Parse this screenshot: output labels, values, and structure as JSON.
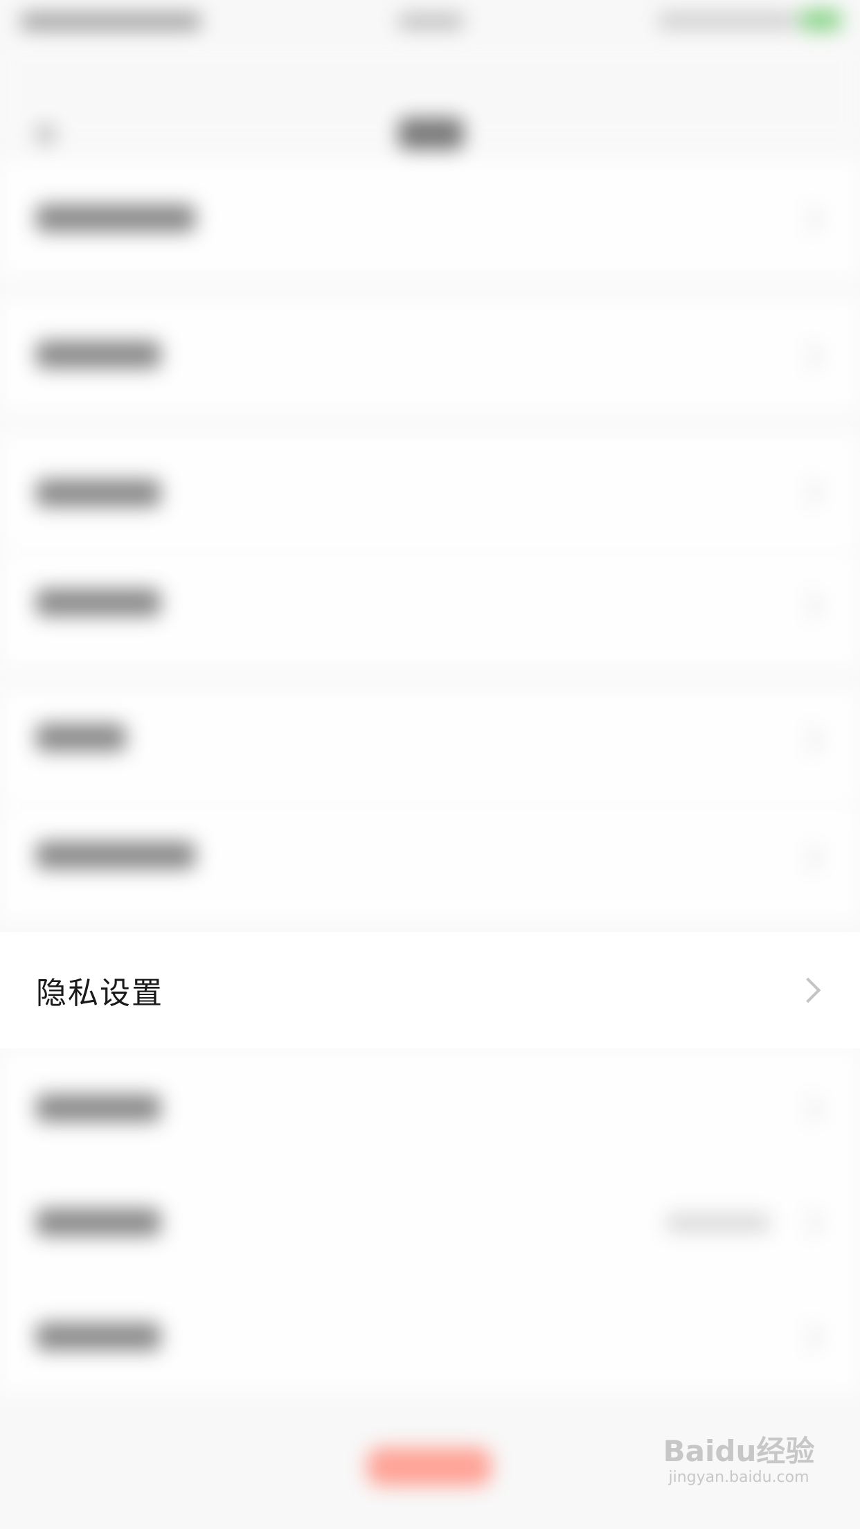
{
  "privacy_row": {
    "label": "隐私设置",
    "icon": "chevron-right-icon"
  },
  "watermark": {
    "brand": "Baidu经验",
    "url": "jingyan.baidu.com"
  },
  "colors": {
    "background": "#f8f8f8",
    "row_background": "#ffffff",
    "label_text": "#1a1a1a",
    "chevron": "#c4c4c4",
    "logout_accent": "#ff9a8c",
    "battery": "#7ccf7c"
  }
}
